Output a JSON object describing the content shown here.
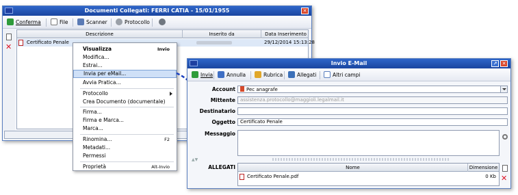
{
  "win1": {
    "title": "Documenti Collegati: FERRI CATIA - 15/01/1955",
    "toolbar": {
      "confirm": "Conferma",
      "file": "File",
      "scanner": "Scanner",
      "protocol": "Protocollo"
    },
    "columns": {
      "description": "Descrizione",
      "inserted_by": "Inserito da",
      "insert_date": "Data Inserimento"
    },
    "rows": [
      {
        "description": "Certificato Penale",
        "inserted_by": "",
        "insert_date": "29/12/2014 15:13:28"
      }
    ]
  },
  "context_menu": {
    "items": [
      {
        "label": "Visualizza",
        "shortcut": "Invio"
      },
      {
        "label": "Modifica..."
      },
      {
        "label": "Estrai..."
      },
      {
        "label": "Invia per eMail..."
      },
      {
        "label": "Avvia Pratica..."
      },
      {
        "label": "Protocollo"
      },
      {
        "label": "Crea Documento (documentale)"
      },
      {
        "label": "Firma..."
      },
      {
        "label": "Firma e Marca..."
      },
      {
        "label": "Marca..."
      },
      {
        "label": "Rinomina...",
        "shortcut": "F2"
      },
      {
        "label": "Metadati..."
      },
      {
        "label": "Permessi"
      },
      {
        "label": "Proprietà",
        "shortcut": "Alt-Invio"
      }
    ]
  },
  "win2": {
    "title": "Invio E-Mail",
    "toolbar": {
      "send": "Invia",
      "cancel": "Annulla",
      "addressbook": "Rubrica",
      "attachments": "Allegati",
      "other_fields": "Altri campi"
    },
    "fields": {
      "account_label": "Account",
      "account_value": "Pec anagrafe",
      "sender_label": "Mittente",
      "sender_value": "assistenza.protocollo@maggioli.legalmail.it",
      "recipient_label": "Destinatario",
      "recipient_value": "",
      "subject_label": "Oggetto",
      "subject_value": "Certificato Penale",
      "message_label": "Messaggio",
      "message_value": ""
    },
    "attachments": {
      "label": "ALLEGATI",
      "columns": {
        "name": "Nome",
        "size": "Dimensione"
      },
      "rows": [
        {
          "name": "Certificato Penale.pdf",
          "size": "0 Kb"
        }
      ]
    }
  },
  "colors": {
    "titlebar": "#2f66c9",
    "highlight": "#cfe0f7",
    "arrow": "#1a3fc0"
  }
}
